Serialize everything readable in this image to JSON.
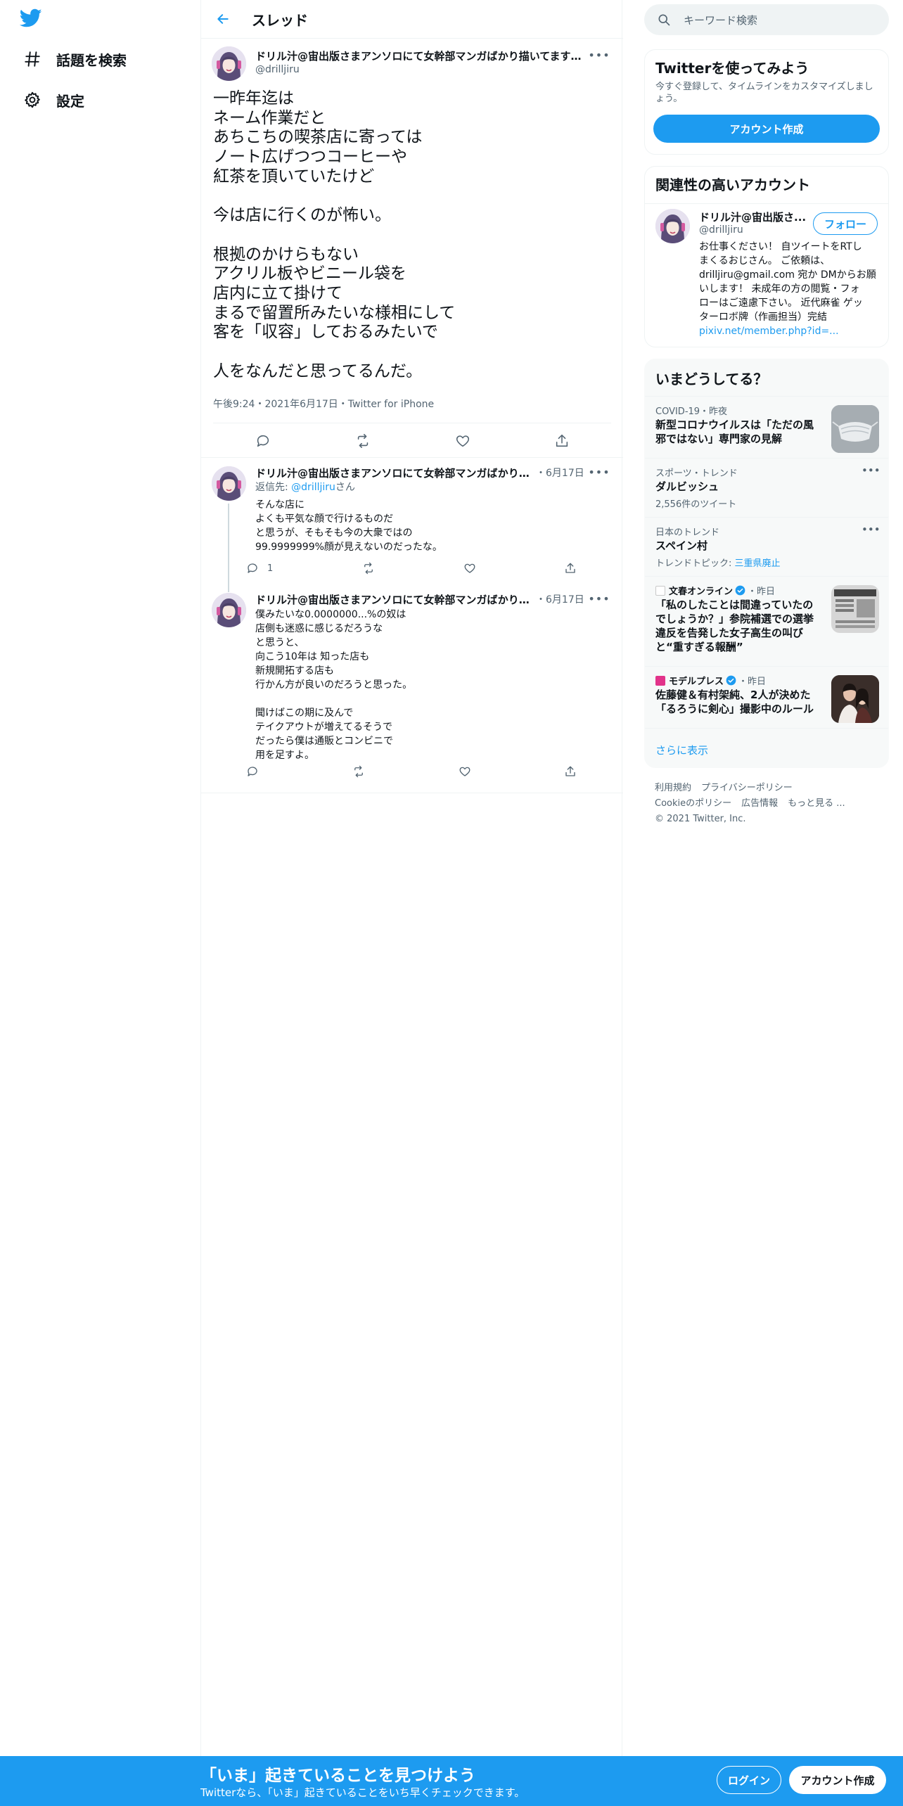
{
  "nav": {
    "logo": "twitter-bird-icon",
    "items": [
      {
        "label": "話題を検索",
        "icon": "hashtag-icon"
      },
      {
        "label": "設定",
        "icon": "gear-icon"
      }
    ]
  },
  "thread": {
    "title": "スレッド"
  },
  "main_tweet": {
    "name": "ドリル汁@宙出版さまアンソロにて女幹部マンガばかり描いてます!...",
    "handle": "@drilljiru",
    "lines": [
      "一昨年迄は",
      "ネーム作業だと",
      "あちこちの喫茶店に寄っては",
      "ノート広げつつコーヒーや",
      "紅茶を頂いていたけど",
      "",
      "今は店に行くのが怖い。",
      "",
      "根拠のかけらもない",
      "アクリル板やビニール袋を",
      "店内に立て掛けて",
      "まるで留置所みたいな様相にして",
      "客を「収容」しておるみたいで",
      "",
      "人をなんだと思ってるんだ。"
    ],
    "meta": "午後9:24・2021年6月17日・Twitter for iPhone"
  },
  "replies": [
    {
      "name": "ドリル汁@宙出版さまアンソロにて女幹部マンガばかり...",
      "date": "・6月17日",
      "to_prefix": "返信先: ",
      "to_mention": "@drilljiru",
      "to_suffix": "さん",
      "lines": [
        "そんな店に",
        "よくも平気な顔で行けるものだ",
        "と思うが、そもそも今の大衆ではの",
        "99.9999999%顔が見えないのだったな。"
      ],
      "reply_count": "1"
    },
    {
      "name": "ドリル汁@宙出版さまアンソロにて女幹部マンガばかり...",
      "date": "・6月17日",
      "lines": [
        "僕みたいな0.0000000...%の奴は",
        "店側も迷惑に感じるだろうな",
        "と思うと、",
        "向こう10年は 知った店も",
        "新規開拓する店も",
        "行かん方が良いのだろうと思った。",
        "",
        "聞けばこの期に及んで",
        "テイクアウトが増えてるそうで",
        "だったら僕は通販とコンビニで",
        "用を足すよ。"
      ],
      "reply_count": ""
    }
  ],
  "search": {
    "placeholder": "キーワード検索"
  },
  "signup_card": {
    "title": "Twitterを使ってみよう",
    "subtitle": "今すぐ登録して、タイムラインをカスタマイズしましょう。",
    "button": "アカウント作成"
  },
  "related": {
    "title": "関連性の高いアカウント",
    "name": "ドリル汁@宙出版さ...",
    "handle": "@drilljiru",
    "follow": "フォロー",
    "bio_lines": [
      "お仕事ください！ 自ツイートをRTし",
      "まくるおじさん。 ご依頼は、",
      "drilljiru@gmail.com 宛か DMからお願",
      "いします！ 未成年の方の閲覧・フォ",
      "ローはご遠慮下さい。 近代麻雀 ゲッ",
      "ターロボ牌（作画担当）完結"
    ],
    "bio_link": "pixiv.net/member.php?id=..."
  },
  "trends": {
    "title": "いまどうしてる？",
    "items": [
      {
        "category": "COVID-19・昨夜",
        "lines": [
          "新型コロナウイルスは「ただの風",
          "邪ではない」専門家の見解"
        ],
        "sub": "",
        "thumb": "mask-photo"
      },
      {
        "category": "スポーツ・トレンド",
        "lines": [
          "ダルビッシュ"
        ],
        "sub": "2,556件のツイート"
      },
      {
        "category": "日本のトレンド",
        "lines": [
          "スペイン村"
        ],
        "sub_prefix": "トレンドトピック: ",
        "sub_link": "三重県廃止"
      },
      {
        "publisher": "文春オンライン",
        "time": "・昨日",
        "lines": [
          "「私のしたことは間違っていたの",
          "でしょうか？」参院補選での選挙",
          "違反を告発した女子高生の叫び",
          "と“重すぎる報酬”"
        ],
        "thumb": "newspaper-photo"
      },
      {
        "publisher": "モデルプレス",
        "time": "・昨日",
        "lines": [
          "佐藤健＆有村架純、2人が決めた",
          "「るろうに剣心」撮影中のルール"
        ],
        "thumb": "couple-photo"
      }
    ],
    "show_more": "さらに表示"
  },
  "footer": {
    "row1": [
      "利用規約",
      "プライバシーポリシー"
    ],
    "row2": [
      "Cookieのポリシー",
      "広告情報",
      "もっと見る ..."
    ],
    "copyright": "© 2021 Twitter, Inc."
  },
  "banner": {
    "title": "「いま」起きていることを見つけよう",
    "subtitle": "Twitterなら、「いま」起きていることをいち早くチェックできます。",
    "login": "ログイン",
    "signup": "アカウント作成"
  },
  "colors": {
    "brand": "#1d9bf0",
    "text": "#0f1419",
    "secondary": "#536471",
    "border": "#eff3f4"
  }
}
